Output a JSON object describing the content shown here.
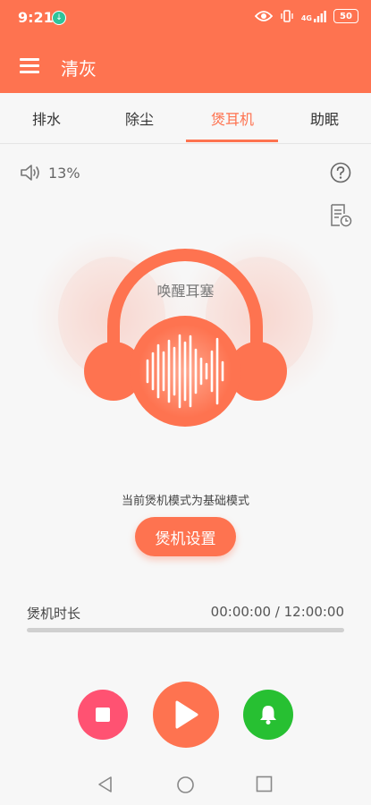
{
  "status_bar": {
    "time": "9:21",
    "app_badge_glyph": "↓",
    "signal_label": "4G",
    "battery": "50"
  },
  "app_bar": {
    "title": "清灰",
    "menu_icon": "hamburger-menu-icon"
  },
  "tabs": [
    {
      "label": "排水",
      "active": false
    },
    {
      "label": "除尘",
      "active": false
    },
    {
      "label": "煲耳机",
      "active": true
    },
    {
      "label": "助眠",
      "active": false
    }
  ],
  "volume": {
    "icon": "speaker-icon",
    "value": "13%"
  },
  "headphone": {
    "caption": "唤醒耳塞",
    "icon": "headphone-waveform-icon"
  },
  "mode_text": "当前煲机模式为基础模式",
  "settings_button": "煲机设置",
  "duration": {
    "label": "煲机时长",
    "time": "00:00:00 / 12:00:00",
    "progress_fraction": 0
  },
  "controls": {
    "stop_icon": "stop-icon",
    "play_icon": "play-icon",
    "bell_icon": "bell-icon"
  },
  "colors": {
    "primary": "#fe7350",
    "stop": "#ff5272",
    "bell": "#27c032",
    "background": "#f7f7f7"
  }
}
